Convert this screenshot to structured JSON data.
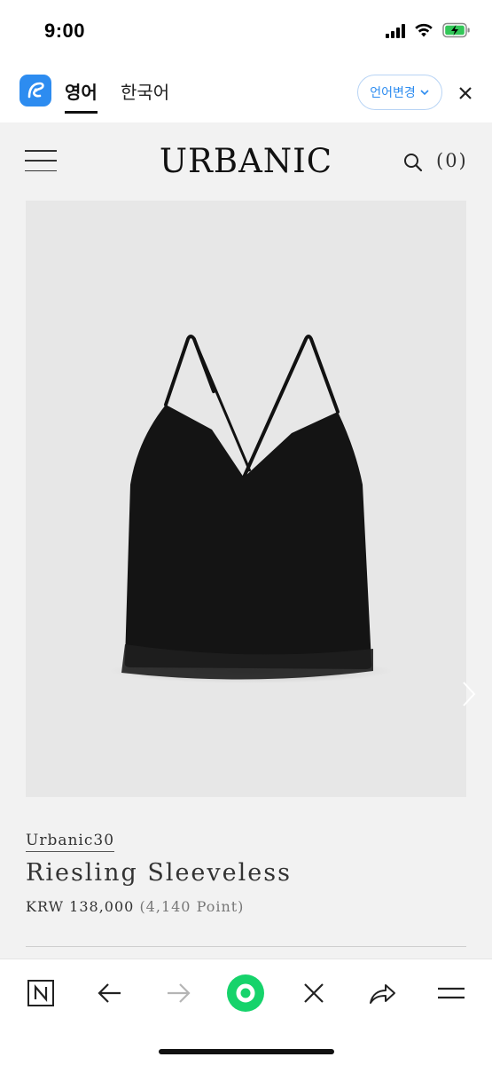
{
  "status_bar": {
    "time": "9:00",
    "icons": [
      "signal-icon",
      "wifi-icon",
      "battery-charging-icon"
    ]
  },
  "translate_bar": {
    "active_tab": "영어",
    "other_tab": "한국어",
    "change_lang_label": "언어변경",
    "accent_color": "#2d8cf0"
  },
  "header": {
    "logo": "URBANIC",
    "cart_count": "(0)"
  },
  "product": {
    "brand": "Urbanic30",
    "name": "Riesling Sleeveless",
    "price": "KRW 138,000",
    "points": "(4,140 Point)"
  },
  "bottom_nav": {
    "items": [
      "naver-home-icon",
      "back-arrow-icon",
      "forward-arrow-icon",
      "green-dot-button",
      "close-icon",
      "share-icon",
      "menu-icon"
    ],
    "green_color": "#16d36b"
  }
}
